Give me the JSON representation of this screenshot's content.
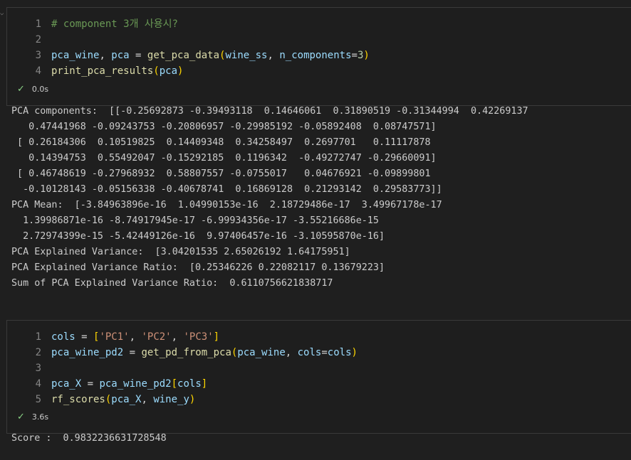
{
  "cells": [
    {
      "lines": [
        {
          "num": "1",
          "tokens": [
            {
              "c": "tok-c",
              "t": "# component 3개 사용시?"
            }
          ]
        },
        {
          "num": "2",
          "tokens": []
        },
        {
          "num": "3",
          "tokens": [
            {
              "c": "tok-v",
              "t": "pca_wine"
            },
            {
              "c": "tok-o",
              "t": ", "
            },
            {
              "c": "tok-v",
              "t": "pca"
            },
            {
              "c": "tok-o",
              "t": " = "
            },
            {
              "c": "tok-f",
              "t": "get_pca_data"
            },
            {
              "c": "tok-p",
              "t": "("
            },
            {
              "c": "tok-v",
              "t": "wine_ss"
            },
            {
              "c": "tok-o",
              "t": ", "
            },
            {
              "c": "tok-v",
              "t": "n_components"
            },
            {
              "c": "tok-o",
              "t": "="
            },
            {
              "c": "tok-n",
              "t": "3"
            },
            {
              "c": "tok-p",
              "t": ")"
            }
          ]
        },
        {
          "num": "4",
          "tokens": [
            {
              "c": "tok-f",
              "t": "print_pca_results"
            },
            {
              "c": "tok-p",
              "t": "("
            },
            {
              "c": "tok-v",
              "t": "pca"
            },
            {
              "c": "tok-p",
              "t": ")"
            }
          ]
        }
      ],
      "status_time": "0.0s",
      "output": [
        "PCA components:  [[-0.25692873 -0.39493118  0.14646061  0.31890519 -0.31344994  0.42269137",
        "   0.47441968 -0.09243753 -0.20806957 -0.29985192 -0.05892408  0.08747571]",
        " [ 0.26184306  0.10519825  0.14409348  0.34258497  0.2697701   0.11117878",
        "   0.14394753  0.55492047 -0.15292185  0.1196342  -0.49272747 -0.29660091]",
        " [ 0.46748619 -0.27968932  0.58807557 -0.0755017   0.04676921 -0.09899801",
        "  -0.10128143 -0.05156338 -0.40678741  0.16869128  0.21293142  0.29583773]]",
        "PCA Mean:  [-3.84963896e-16  1.04990153e-16  2.18729486e-17  3.49967178e-17",
        "  1.39986871e-16 -8.74917945e-17 -6.99934356e-17 -3.55216686e-15",
        "  2.72974399e-15 -5.42449126e-16  9.97406457e-16 -3.10595870e-16]",
        "PCA Explained Variance:  [3.04201535 2.65026192 1.64175951]",
        "PCA Explained Variance Ratio:  [0.25346226 0.22082117 0.13679223]",
        "Sum of PCA Explained Variance Ratio:  0.6110756621838717"
      ]
    },
    {
      "lines": [
        {
          "num": "1",
          "tokens": [
            {
              "c": "tok-v",
              "t": "cols"
            },
            {
              "c": "tok-o",
              "t": " = "
            },
            {
              "c": "tok-p",
              "t": "["
            },
            {
              "c": "tok-s",
              "t": "'PC1'"
            },
            {
              "c": "tok-o",
              "t": ", "
            },
            {
              "c": "tok-s",
              "t": "'PC2'"
            },
            {
              "c": "tok-o",
              "t": ", "
            },
            {
              "c": "tok-s",
              "t": "'PC3'"
            },
            {
              "c": "tok-p",
              "t": "]"
            }
          ]
        },
        {
          "num": "2",
          "tokens": [
            {
              "c": "tok-v",
              "t": "pca_wine_pd2"
            },
            {
              "c": "tok-o",
              "t": " = "
            },
            {
              "c": "tok-f",
              "t": "get_pd_from_pca"
            },
            {
              "c": "tok-p",
              "t": "("
            },
            {
              "c": "tok-v",
              "t": "pca_wine"
            },
            {
              "c": "tok-o",
              "t": ", "
            },
            {
              "c": "tok-v",
              "t": "cols"
            },
            {
              "c": "tok-o",
              "t": "="
            },
            {
              "c": "tok-v",
              "t": "cols"
            },
            {
              "c": "tok-p",
              "t": ")"
            }
          ]
        },
        {
          "num": "3",
          "tokens": []
        },
        {
          "num": "4",
          "tokens": [
            {
              "c": "tok-v",
              "t": "pca_X"
            },
            {
              "c": "tok-o",
              "t": " = "
            },
            {
              "c": "tok-v",
              "t": "pca_wine_pd2"
            },
            {
              "c": "tok-p",
              "t": "["
            },
            {
              "c": "tok-v",
              "t": "cols"
            },
            {
              "c": "tok-p",
              "t": "]"
            }
          ]
        },
        {
          "num": "5",
          "tokens": [
            {
              "c": "tok-f",
              "t": "rf_scores"
            },
            {
              "c": "tok-p",
              "t": "("
            },
            {
              "c": "tok-v",
              "t": "pca_X"
            },
            {
              "c": "tok-o",
              "t": ", "
            },
            {
              "c": "tok-v",
              "t": "wine_y"
            },
            {
              "c": "tok-p",
              "t": ")"
            }
          ]
        }
      ],
      "status_time": "3.6s",
      "output": [
        "Score :  0.9832236631728548"
      ]
    }
  ],
  "icons": {
    "status_check": "check-icon",
    "gutter_mark": "chevron-icon"
  },
  "colors": {
    "background": "#1f1f1f",
    "success": "#89d185",
    "line_number": "#858585"
  }
}
